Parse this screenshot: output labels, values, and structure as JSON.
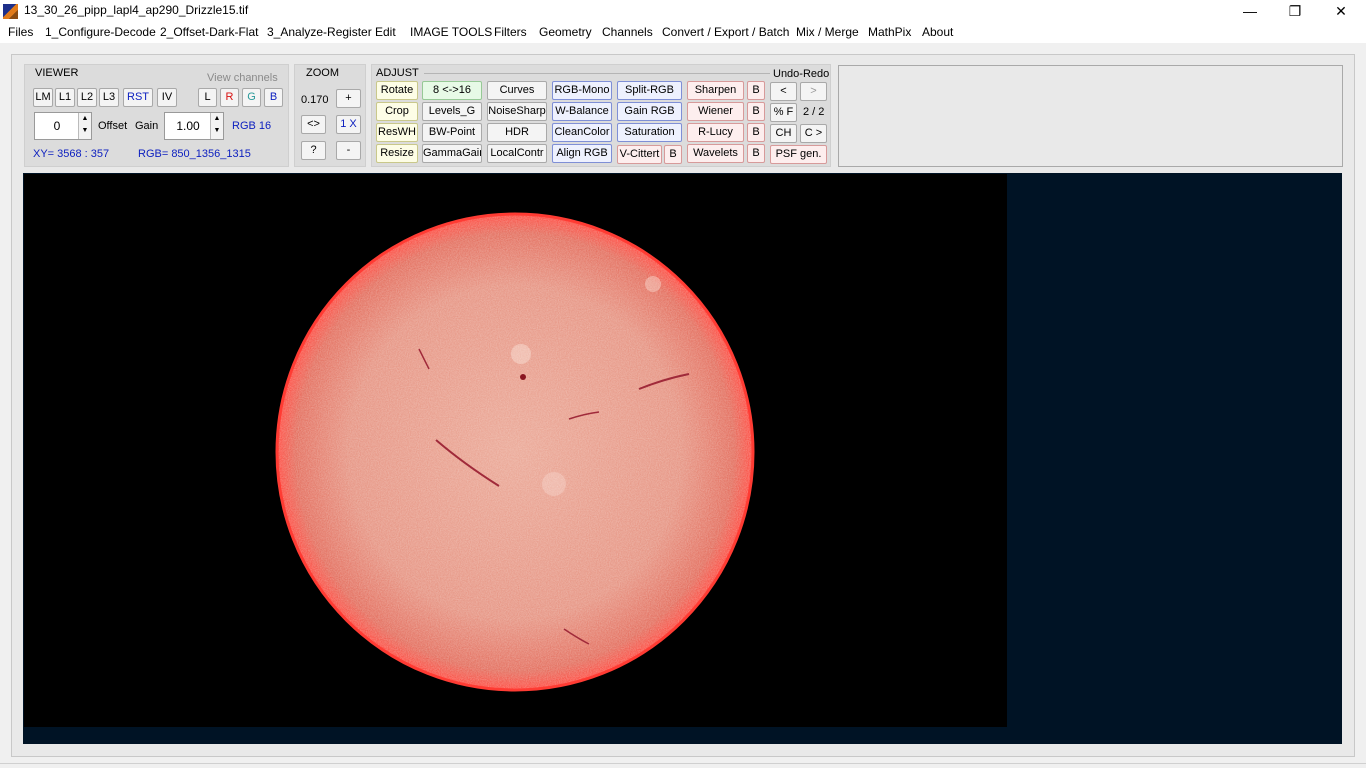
{
  "window": {
    "title": "13_30_26_pipp_lapl4_ap290_Drizzle15.tif",
    "minimize": "—",
    "restore": "❐",
    "close": "✕"
  },
  "menu": [
    "Files",
    "1_Configure-Decode",
    "2_Offset-Dark-Flat",
    "3_Analyze-Register",
    "Edit",
    "IMAGE TOOLS",
    "Filters",
    "Geometry",
    "Channels",
    "Convert / Export / Batch",
    "Mix / Merge",
    "MathPix",
    "About"
  ],
  "viewer": {
    "title": "VIEWER",
    "buttons": [
      "LM",
      "L1",
      "L2",
      "L3",
      "RST",
      "IV"
    ],
    "view_channels_label": "View channels",
    "channels": [
      "L",
      "R",
      "G",
      "B"
    ],
    "offset_value": "0",
    "offset_label": "Offset",
    "gain_label": "Gain",
    "gain_value": "1.00",
    "rgb_mode": "RGB 16",
    "xy_readout": "XY=  3568 : 357",
    "rgb_readout": "RGB=  850_1356_1315"
  },
  "zoom": {
    "title": "ZOOM",
    "level": "0.170",
    "plus": "+",
    "fit": "<>",
    "one_x": "1 X",
    "help": "?",
    "minus": "-"
  },
  "adjust": {
    "title": "ADJUST",
    "undo_redo_label": "Undo-Redo",
    "col_yellow": [
      "Rotate",
      "Crop",
      "ResWH",
      "Resize"
    ],
    "col_green": [
      "8 <->16",
      "Levels_G",
      "BW-Point",
      "GammaGain"
    ],
    "col_neutral": [
      "Curves",
      "NoiseSharp",
      "HDR",
      "LocalContr"
    ],
    "col_blue1": [
      "RGB-Mono",
      "W-Balance",
      "CleanColor",
      "Align RGB"
    ],
    "col_blue2": [
      "Split-RGB",
      "Gain RGB",
      "Saturation"
    ],
    "vcittert": "V-Cittert",
    "col_red": [
      "Sharpen",
      "Wiener",
      "R-Lucy",
      "Wavelets"
    ],
    "b_label": "B",
    "undo": "<",
    "redo": ">",
    "pct_f": "% F",
    "history_count": "2 / 2",
    "ch": "CH",
    "c_next": "C >",
    "psf": "PSF gen."
  }
}
